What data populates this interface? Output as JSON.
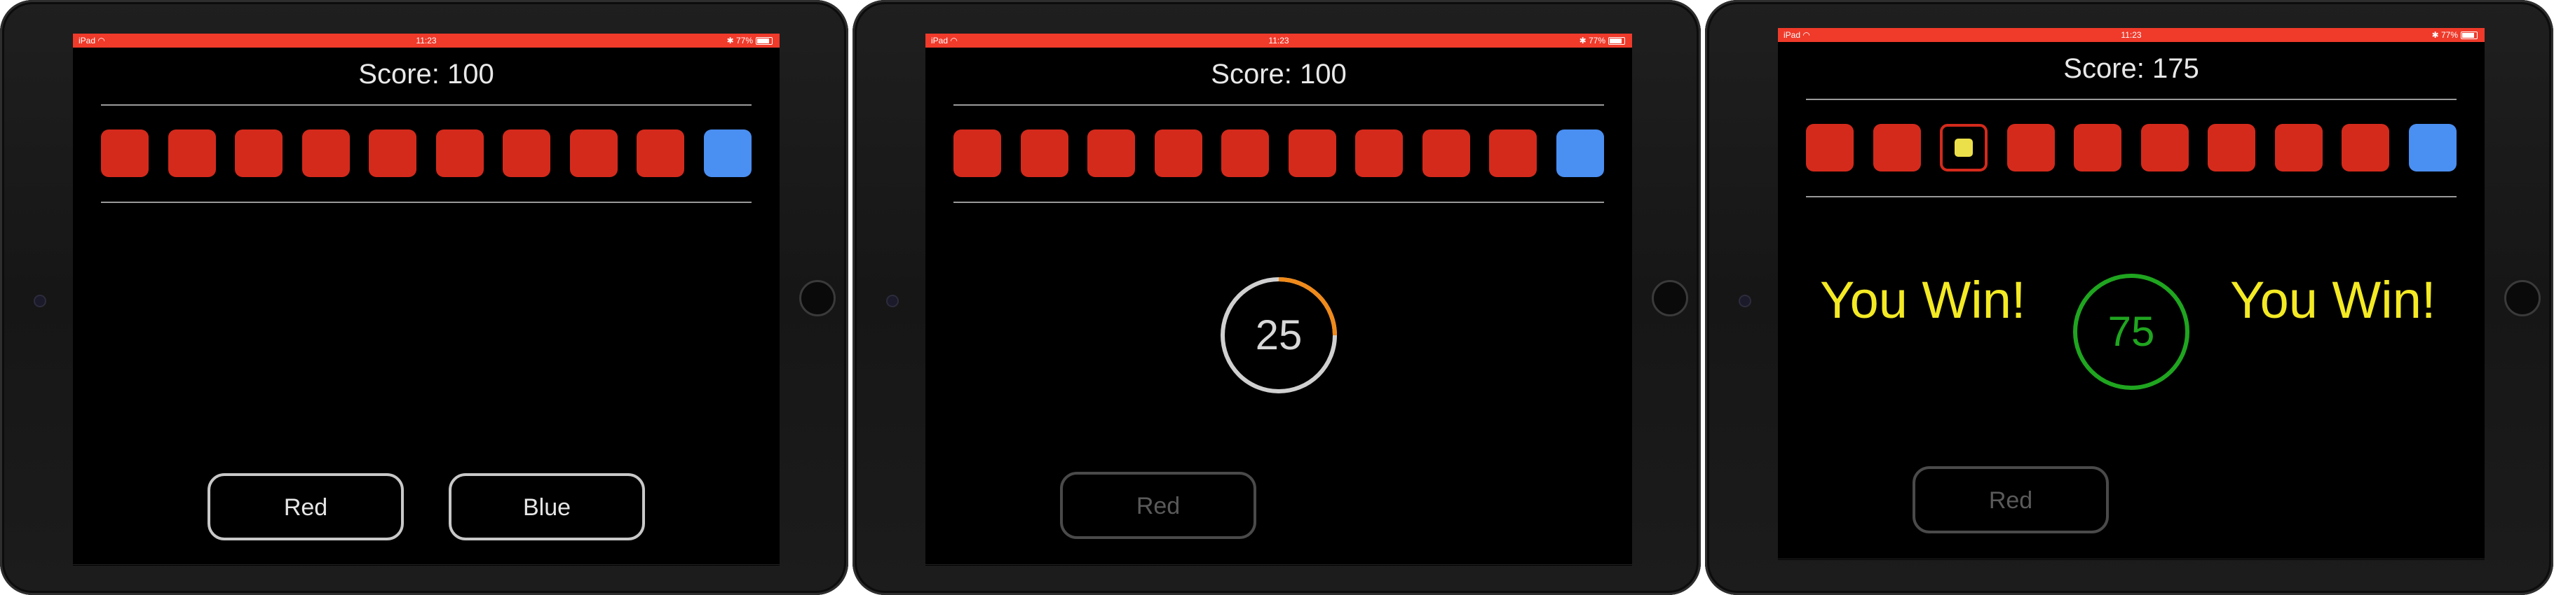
{
  "screens": [
    {
      "status": {
        "left": "iPad",
        "time": "11:23",
        "battery": "77%"
      },
      "score": "Score: 100",
      "boxes": [
        "red",
        "red",
        "red",
        "red",
        "red",
        "red",
        "red",
        "red",
        "red",
        "blue"
      ],
      "buttons": {
        "red": "Red",
        "blue": "Blue"
      }
    },
    {
      "status": {
        "left": "iPad",
        "time": "11:23",
        "battery": "77%"
      },
      "score": "Score: 100",
      "boxes": [
        "red",
        "red",
        "red",
        "red",
        "red",
        "red",
        "red",
        "red",
        "red",
        "blue"
      ],
      "timer": {
        "value": "25",
        "progress": 0.25
      },
      "buttons": {
        "red": "Red"
      }
    },
    {
      "status": {
        "left": "iPad",
        "time": "11:23",
        "battery": "77%"
      },
      "score": "Score: 175",
      "boxes": [
        "red",
        "red",
        "selected-yellow",
        "red",
        "red",
        "red",
        "red",
        "red",
        "red",
        "blue"
      ],
      "timer": {
        "value": "75"
      },
      "win_left": "You Win!",
      "win_right": "You Win!",
      "buttons": {
        "red": "Red"
      }
    }
  ],
  "colors": {
    "statusbar": "#f03a2a",
    "red_box": "#d42a1c",
    "blue_box": "#4a8ff2",
    "yellow": "#f4ea24",
    "green": "#1fa51f",
    "orange_arc": "#f08a1a"
  }
}
